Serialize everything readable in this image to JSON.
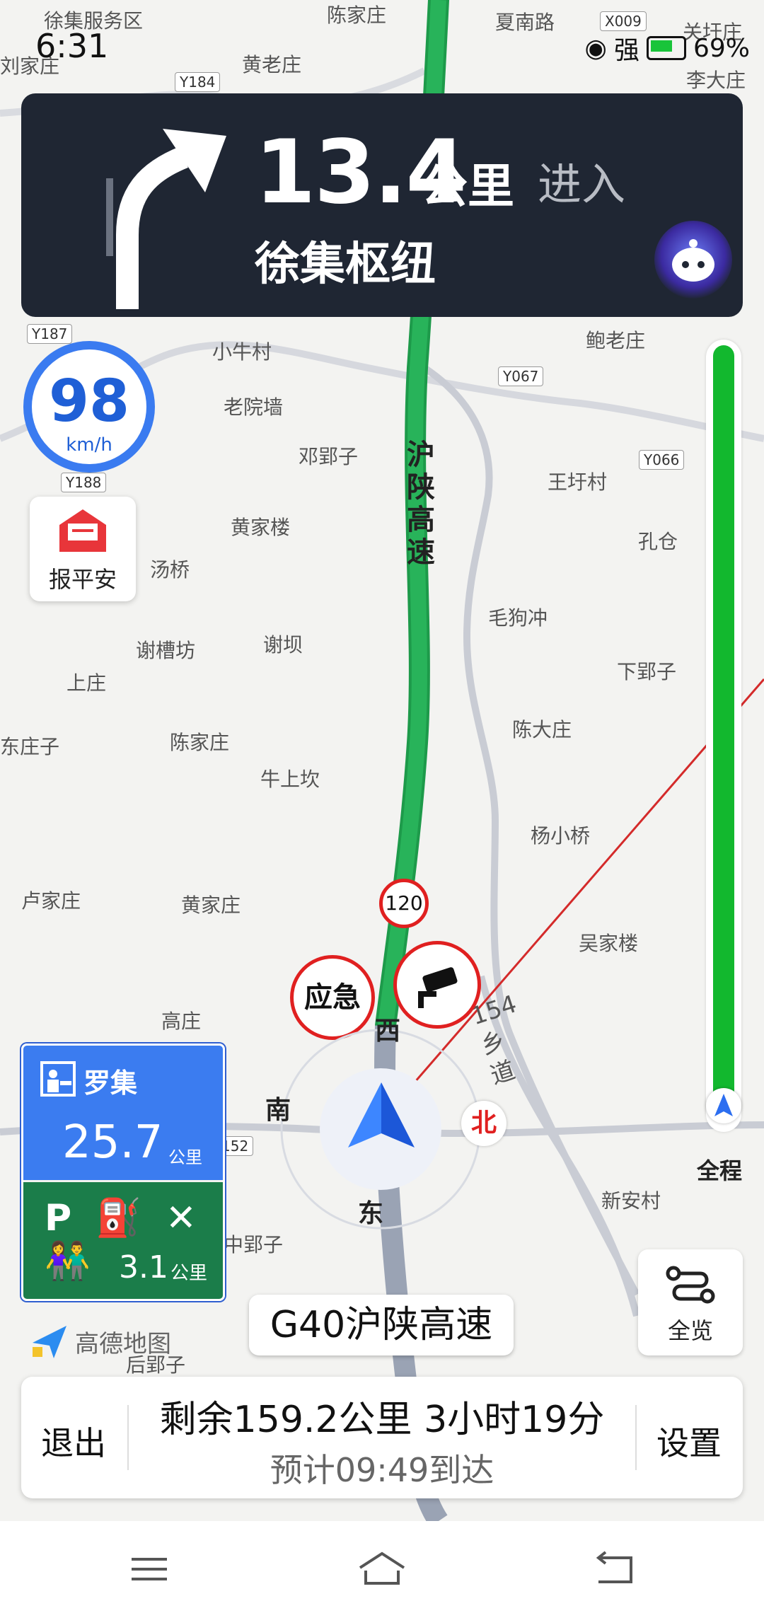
{
  "status_bar": {
    "time": "6:31",
    "signal": "强",
    "battery": "69%"
  },
  "nav": {
    "distance": "13.4",
    "unit": "公里",
    "action": "进入",
    "road": "徐集枢纽"
  },
  "speed": {
    "value": "98",
    "unit": "km/h"
  },
  "safety_button": {
    "label": "报平安"
  },
  "speed_limit": "120",
  "pins": {
    "emergency": "应急"
  },
  "compass": {
    "west": "西",
    "south": "南",
    "east": "东",
    "north": "北"
  },
  "progress": {
    "label": "全程",
    "fraction_remaining": 1.0
  },
  "service_area": {
    "name": "罗集",
    "distance": "25.7",
    "unit": "公里",
    "amenities": "P ⛽ ✕ 👫",
    "amenity_distance": "3.1",
    "amenity_unit": "公里"
  },
  "current_road": "G40沪陕高速",
  "overview": {
    "label": "全览"
  },
  "logo": "高德地图",
  "summary": {
    "exit": "退出",
    "remaining": "剩余159.2公里  3小时19分",
    "eta": "预计09:49到达",
    "settings": "设置"
  },
  "map_labels": {
    "highway": "沪陕高速",
    "county_road": "154乡道",
    "places": [
      "徐集服务区",
      "陈家庄",
      "夏南路",
      "关圩庄",
      "刘家庄",
      "黄老庄",
      "李大庄",
      "小牛村",
      "鲍老庄",
      "老院墙",
      "邓郢子",
      "王圩村",
      "黄家楼",
      "孔仓",
      "汤桥",
      "毛狗冲",
      "谢槽坊",
      "谢坝",
      "下郢子",
      "上庄",
      "陈大庄",
      "东庄子",
      "陈家庄",
      "牛上坎",
      "杨小桥",
      "卢家庄",
      "黄家庄",
      "吴家楼",
      "高庄",
      "新安村",
      "中郢子",
      "后郢子"
    ],
    "road_codes": [
      "Y184",
      "X009",
      "Y187",
      "Y067",
      "Y066",
      "Y188",
      "152"
    ]
  }
}
